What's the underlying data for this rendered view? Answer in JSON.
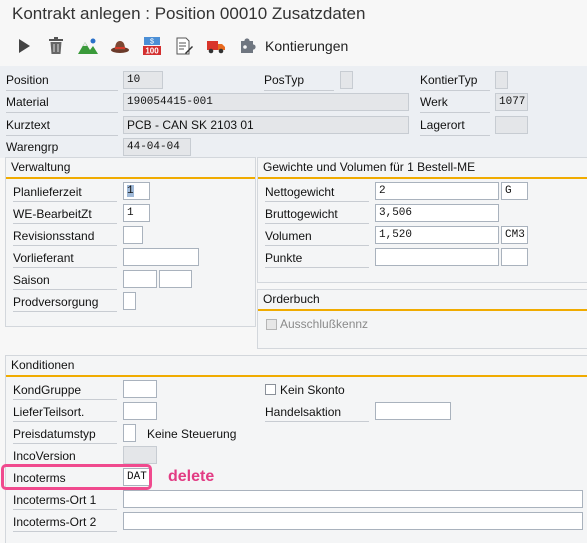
{
  "window": {
    "title": "Kontrakt anlegen : Position 00010 Zusatzdaten"
  },
  "toolbar": {
    "icons": [
      "execute-icon",
      "trash-icon",
      "mountains-icon",
      "hat-icon",
      "price-100-icon",
      "document-edit-icon",
      "truck-icon",
      "puzzle-icon"
    ],
    "kontierungen_label": "Kontierungen"
  },
  "header": {
    "position_label": "Position",
    "position_value": "10",
    "postyp_label": "PosTyp",
    "postyp_value": "",
    "kontiertyp_label": "KontierTyp",
    "kontiertyp_value": "",
    "material_label": "Material",
    "material_value": "190054415-001",
    "werk_label": "Werk",
    "werk_value": "1077",
    "kurztext_label": "Kurztext",
    "kurztext_value": "PCB - CAN SK 2103 01",
    "lagerort_label": "Lagerort",
    "lagerort_value": "",
    "warengrp_label": "Warengrp",
    "warengrp_value": "44-04-04"
  },
  "verwaltung": {
    "title": "Verwaltung",
    "planlieferzeit_label": "Planlieferzeit",
    "planlieferzeit_value": "1",
    "we_label": "WE-BearbeitZt",
    "we_value": "1",
    "revisionsstand_label": "Revisionsstand",
    "revisionsstand_value": "",
    "vorlieferant_label": "Vorlieferant",
    "vorlieferant_value": "",
    "saison_label": "Saison",
    "saison_value1": "",
    "saison_value2": "",
    "prodversorgung_label": "Prodversorgung",
    "prodversorgung_value": ""
  },
  "gewichte": {
    "title": "Gewichte und Volumen für 1 Bestell-ME",
    "netto_label": "Nettogewicht",
    "netto_value": "2",
    "netto_unit": "G",
    "brutto_label": "Bruttogewicht",
    "brutto_value": "3,506",
    "volumen_label": "Volumen",
    "volumen_value": "1,520",
    "volumen_unit": "CM3",
    "punkte_label": "Punkte",
    "punkte_value": "",
    "punkte_unit": ""
  },
  "orderbuch": {
    "title": "Orderbuch",
    "ausschluss_label": "Ausschlußkennz"
  },
  "konditionen": {
    "title": "Konditionen",
    "kondgruppe_label": "KondGruppe",
    "kondgruppe_value": "",
    "kein_skonto_label": "Kein Skonto",
    "lieferteilsort_label": "LieferTeilsort.",
    "lieferteilsort_value": "",
    "handelsaktion_label": "Handelsaktion",
    "handelsaktion_value": "",
    "preisdatumstyp_label": "Preisdatumstyp",
    "preisdatumstyp_value": "",
    "preisdatumstyp_text": "Keine Steuerung",
    "incoversion_label": "IncoVersion",
    "incoversion_value": "",
    "incoterms_label": "Incoterms",
    "incoterms_value": "DAT",
    "incoterms_ort1_label": "Incoterms-Ort 1",
    "incoterms_ort1_value": "",
    "incoterms_ort2_label": "Incoterms-Ort 2",
    "incoterms_ort2_value": ""
  },
  "annotation": {
    "text": "delete",
    "color": "#e23b83"
  }
}
